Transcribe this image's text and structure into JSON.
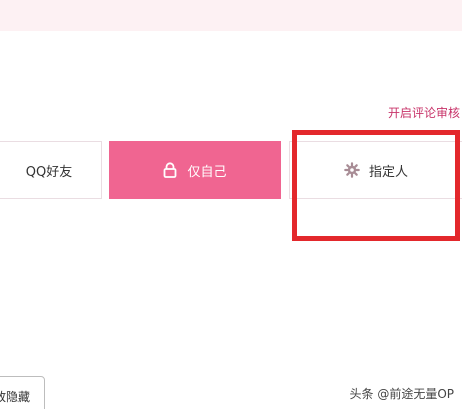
{
  "header": {
    "comment_toggle": "开启评论审核"
  },
  "visibility_options": [
    {
      "label": "QQ好友",
      "icon": null,
      "selected": false
    },
    {
      "label": "仅自己",
      "icon": "lock-icon",
      "selected": true
    },
    {
      "label": "指定人",
      "icon": "gear-icon",
      "selected": false
    }
  ],
  "footer": {
    "hide_button": "放隐藏"
  },
  "watermark": "头条 @前途无量OP",
  "colors": {
    "accent": "#f06591",
    "link": "#c8346a",
    "highlight": "#e3282c",
    "top_band": "#fdf1f3"
  }
}
